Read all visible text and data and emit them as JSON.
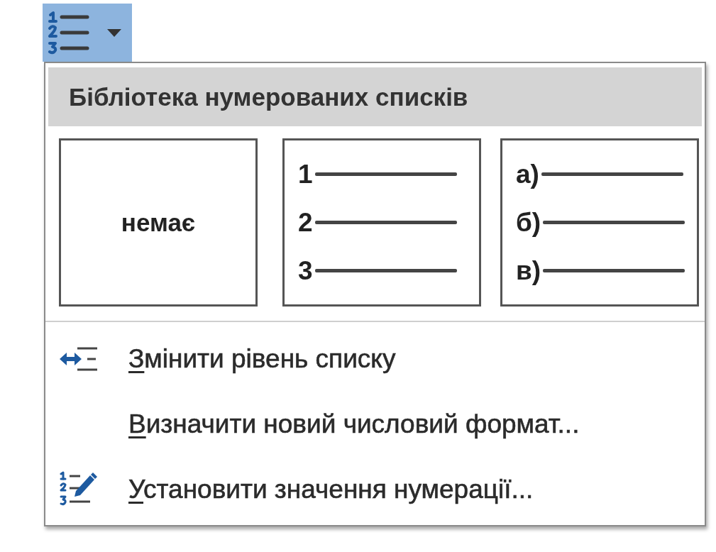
{
  "toolbar_button": {
    "active": true
  },
  "menu": {
    "header": "Бібліотека нумерованих списків",
    "tiles": [
      {
        "kind": "none",
        "label": "немає",
        "selected": false
      },
      {
        "kind": "list",
        "markers": [
          "1",
          "2",
          "3"
        ],
        "selected": false
      },
      {
        "kind": "list",
        "markers": [
          "а)",
          "б)",
          "в)"
        ],
        "selected": false
      }
    ],
    "items": [
      {
        "kind": "arrows",
        "label": "Змінити рівень списку",
        "mnemonic_shown": true
      },
      {
        "kind": "plain",
        "label": "Визначити новий числовий формат...",
        "mnemonic_shown": true
      },
      {
        "kind": "pen",
        "label": "Установити значення нумерації...",
        "mnemonic_shown": true
      }
    ]
  }
}
